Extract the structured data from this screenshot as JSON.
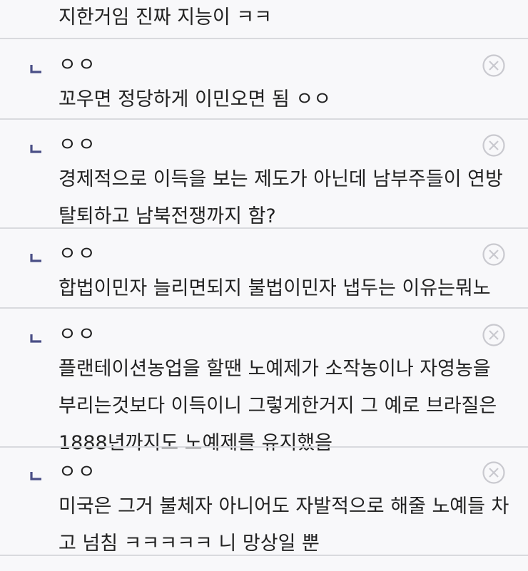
{
  "top_comment": {
    "text": "지한거임 진짜 지능이 ㅋㅋ"
  },
  "replies": [
    {
      "author": "ㅇㅇ",
      "body": "꼬우면 정당하게 이민오면 됨 ㅇㅇ"
    },
    {
      "author": "ㅇㅇ",
      "body": "경제적으로 이득을 보는 제도가 아닌데 남부주들이 연방\n탈퇴하고 남북전쟁까지 함?"
    },
    {
      "author": "ㅇㅇ",
      "body": "합법이민자 늘리면되지 불법이민자 냅두는 이유는뭐노"
    },
    {
      "author": "ㅇㅇ",
      "body": "플랜테이션농업을 할땐 노예제가 소작농이나 자영농을\n부리는것보다 이득이니 그렇게한거지 그 예로 브라질은\n1888년까지도 노예제를 유지했음"
    },
    {
      "author": "ㅇㅇ",
      "body": "미국은 그거 불체자 아니어도 자발적으로 해줄 노예들 차\n고 넘침 ㅋㅋㅋㅋㅋ 니 망상일 뿐"
    }
  ],
  "icons": {
    "reply": "reply-arrow-icon",
    "close": "close-circle-icon"
  },
  "colors": {
    "background": "#f8f8fa",
    "divider": "#d9dade",
    "reply_arrow": "#4a4f86",
    "close_icon": "#c9c9cf"
  }
}
